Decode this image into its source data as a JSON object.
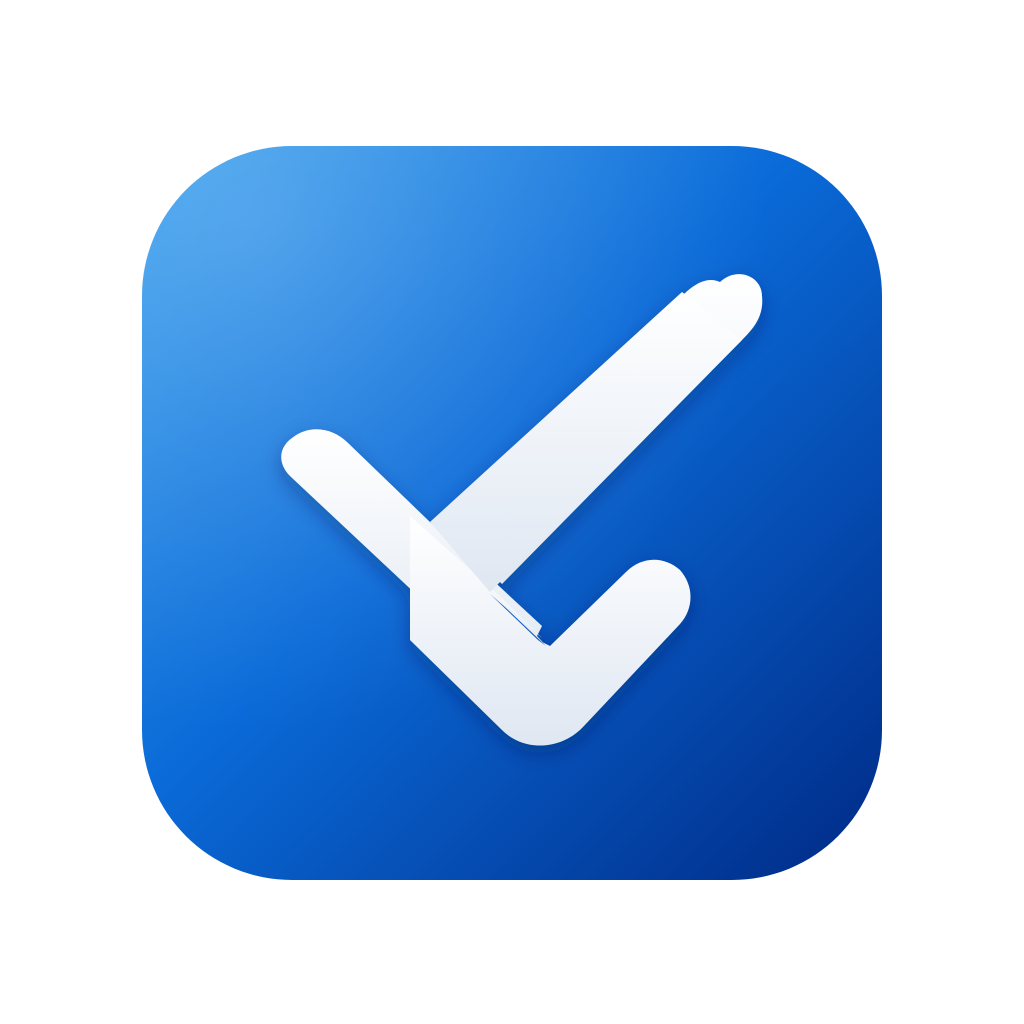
{
  "icon": {
    "name": "checkmark-icon",
    "colors": {
      "gradient_start": "#3aa0ee",
      "gradient_mid": "#0a6ad8",
      "gradient_end": "#002a86",
      "check_fill_top": "#ffffff",
      "check_fill_bottom": "#dfe7f2",
      "background": "#ffffff"
    }
  }
}
